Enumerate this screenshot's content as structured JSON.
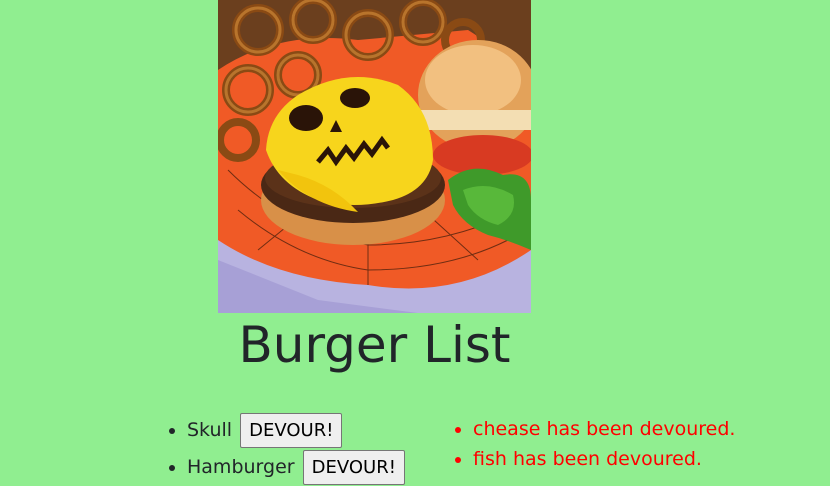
{
  "page": {
    "title": "Burger List",
    "background": "#90ee90"
  },
  "burgers": [
    {
      "name": "Skull",
      "button": "DEVOUR!"
    },
    {
      "name": "Hamburger",
      "button": "DEVOUR!"
    }
  ],
  "devoured": [
    "chease has been devoured.",
    "fish has been devoured."
  ],
  "colors": {
    "devoured_text": "#ff0000",
    "title_text": "#212529"
  }
}
